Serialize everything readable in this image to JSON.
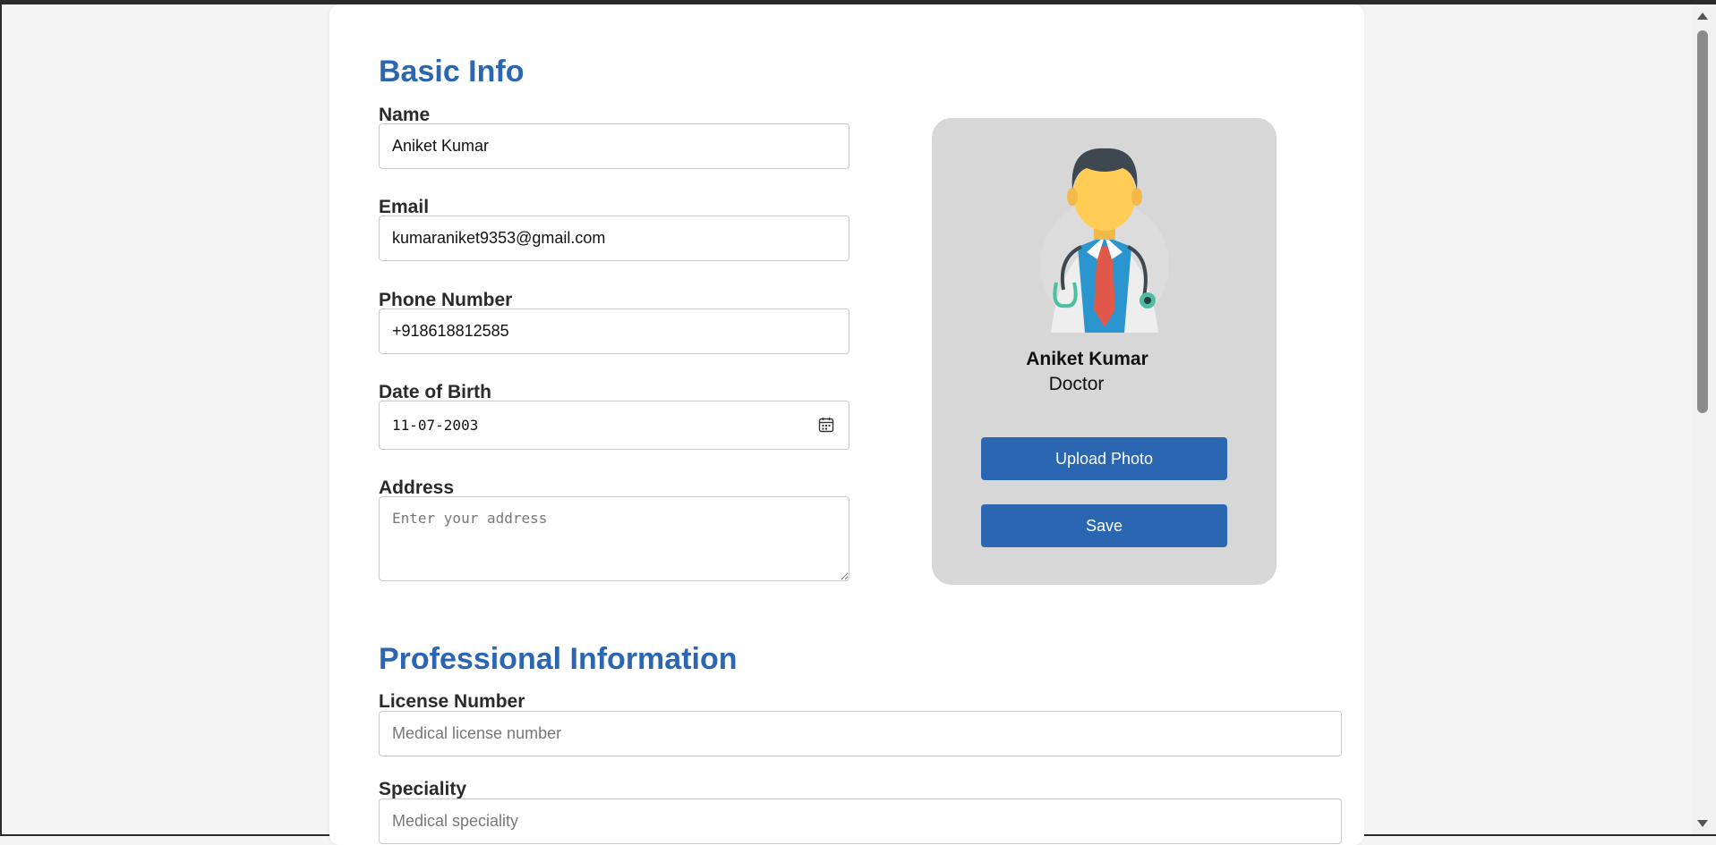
{
  "basic_info": {
    "title": "Basic Info",
    "name_label": "Name",
    "name_value": "Aniket Kumar",
    "email_label": "Email",
    "email_value": "kumaraniket9353@gmail.com",
    "phone_label": "Phone Number",
    "phone_value": "+918618812585",
    "dob_label": "Date of Birth",
    "dob_value": "11-07-2003",
    "address_label": "Address",
    "address_placeholder": "Enter your address"
  },
  "profile": {
    "name": "Aniket Kumar",
    "role": "Doctor",
    "upload_label": "Upload Photo",
    "save_label": "Save",
    "avatar_icon": "doctor-avatar-icon"
  },
  "professional_info": {
    "title": "Professional Information",
    "license_label": "License Number",
    "license_placeholder": "Medical license number",
    "speciality_label": "Speciality",
    "speciality_placeholder": "Medical speciality"
  },
  "colors": {
    "accent": "#2a66b2",
    "page_background": "#f4f4f4",
    "profile_card_background": "#d7d7d7"
  }
}
